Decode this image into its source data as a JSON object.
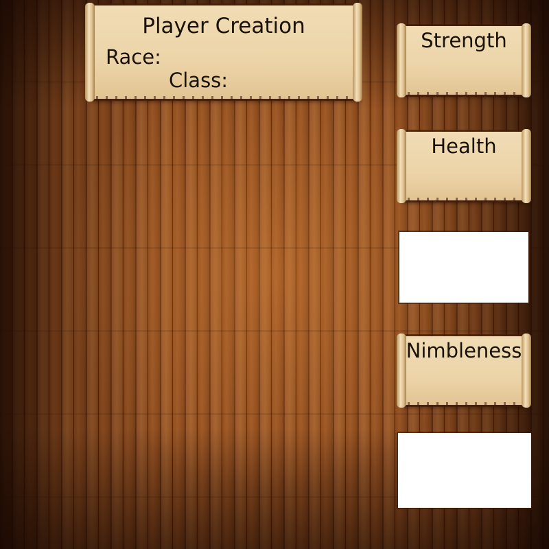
{
  "title_panel": {
    "title": "Player Creation",
    "race_label": "Race:",
    "class_label": "Class:"
  },
  "stats": {
    "strength_label": "Strength",
    "health_label": "Health",
    "nimbleness_label": "Nimbleness"
  },
  "colors": {
    "parchment": "#ecd4a8",
    "wood": "#8a4a1e",
    "text": "#1a1206"
  }
}
